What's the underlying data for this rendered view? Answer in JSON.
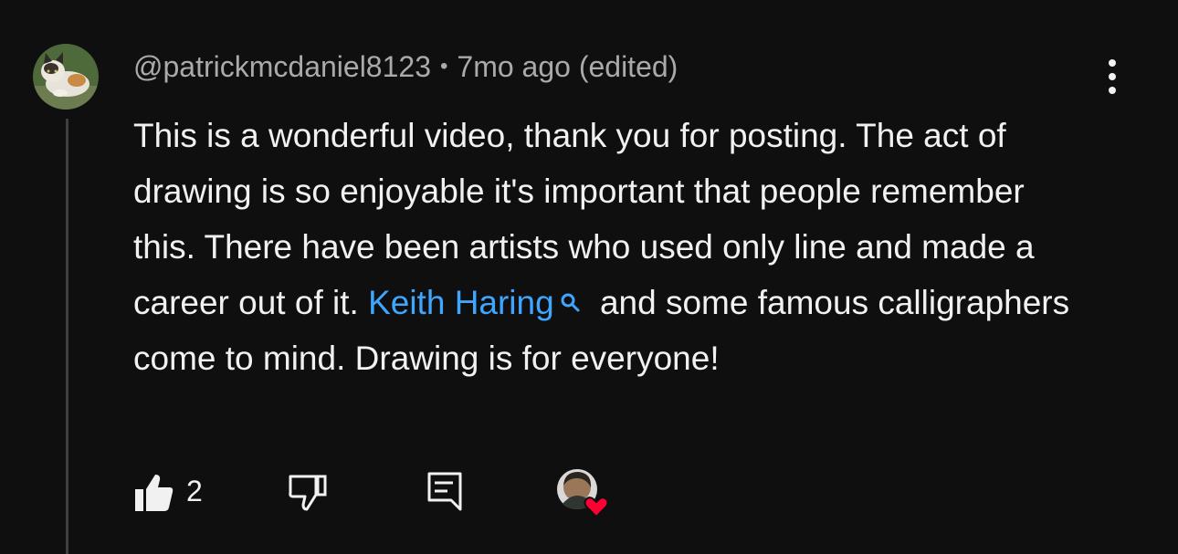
{
  "comment": {
    "author": "@patrickmcdaniel8123",
    "separator": "•",
    "time": "7mo ago",
    "edited": "(edited)",
    "text_part1": "This is a wonderful video, thank you for posting. The act of drawing is so enjoyable it's important that people remember this. There have been artists who used only line and made a career out of it. ",
    "link_text": "Keith Haring",
    "text_part2": " and some famous calligraphers come to mind. Drawing is for everyone!"
  },
  "actions": {
    "like_count": "2"
  },
  "icons": {
    "avatar": "avatar-cat-photo",
    "menu": "more-vert-icon",
    "search": "search-icon",
    "like": "thumb-up-icon",
    "dislike": "thumb-down-icon",
    "reply": "reply-comment-icon",
    "heart": "creator-heart-icon"
  },
  "colors": {
    "background": "#0f0f0f",
    "text": "#f1f1f1",
    "meta": "#aaaaaa",
    "link": "#3ea6ff",
    "heart": "#ff0033",
    "thread_line": "#3f3f3f"
  }
}
